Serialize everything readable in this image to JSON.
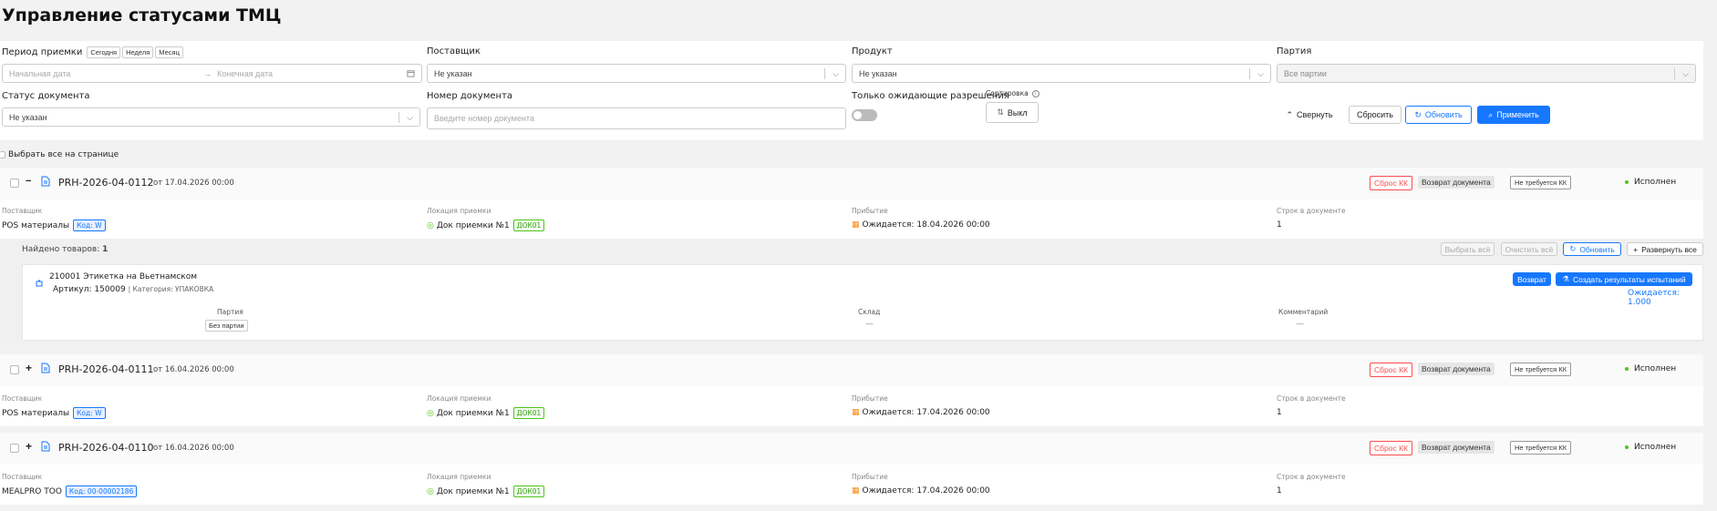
{
  "page": {
    "title": "Управление статусами ТМЦ"
  },
  "filters": {
    "period_label": "Период приемки",
    "period_presets": [
      "Сегодня",
      "Неделя",
      "Месяц"
    ],
    "start_date_placeholder": "Начальная дата",
    "date_arrow": "→",
    "end_date_placeholder": "Конечная дата",
    "supplier_label": "Поставщик",
    "supplier_value": "Не указан",
    "product_label": "Продукт",
    "product_value": "Не указан",
    "batch_label": "Партия",
    "batch_value": "Все партии",
    "doc_status_label": "Статус документа",
    "doc_status_value": "Не указан",
    "doc_number_label": "Номер документа",
    "doc_number_placeholder": "Введите номер документа",
    "pending_only_label": "Только ожидающие разрешения",
    "sort_label": "Сортировка",
    "sort_value": "Выкл",
    "collapse_label": "Свернуть",
    "reset_label": "Сбросить",
    "refresh_label": "Обновить",
    "apply_label": "Применить"
  },
  "select_all_label": "Выбрать все на странице",
  "labels": {
    "supplier": "Поставщик",
    "location": "Локация приемки",
    "arrival": "Прибытие",
    "lines": "Строк в документе",
    "from": "от"
  },
  "documents": [
    {
      "number": "PRH-2026-04-0112",
      "date": "17.04.2026 00:00",
      "expand_glyph": "−",
      "tags": [
        "Сброс КК",
        "Возврат документа",
        "Не требуется КК"
      ],
      "status": "Исполнен",
      "supplier": "POS материалы",
      "supplier_code": "Код: W",
      "location": "Док приемки №1",
      "location_code": "ДОК01",
      "arrival": "Ожидается: 18.04.2026 00:00",
      "lines": "1"
    },
    {
      "number": "PRH-2026-04-0111",
      "date": "16.04.2026 00:00",
      "expand_glyph": "+",
      "tags": [
        "Сброс КК",
        "Возврат документа",
        "Не требуется КК"
      ],
      "status": "Исполнен",
      "supplier": "POS материалы",
      "supplier_code": "Код: W",
      "location": "Док приемки №1",
      "location_code": "ДОК01",
      "arrival": "Ожидается: 17.04.2026 00:00",
      "lines": "1"
    },
    {
      "number": "PRH-2026-04-0110",
      "date": "16.04.2026 00:00",
      "expand_glyph": "+",
      "tags": [
        "Сброс КК",
        "Возврат документа",
        "Не требуется КК"
      ],
      "status": "Исполнен",
      "supplier": "MEALPRO TOO",
      "supplier_code": "Код: 00-00002186",
      "location": "Док приемки №1",
      "location_code": "ДОК01",
      "arrival": "Ожидается: 17.04.2026 00:00",
      "lines": "1"
    }
  ],
  "items_panel": {
    "found_label": "Найдено товаров:",
    "found_count": "1",
    "select_all": "Выбрать всё",
    "clear_all": "Очистить всё",
    "refresh": "Обновить",
    "expand_all": "Развернуть все",
    "item": {
      "name": "210001 Этикетка на Вьетнамском",
      "article": "Артикул: 150009",
      "category": "| Категория: УПАКОВКА",
      "return_btn": "Возврат",
      "create_results_btn": "Создать результаты испытаний",
      "expected": "Ожидается: 1.000",
      "batch_label": "Партия",
      "batch_value": "Без партии",
      "warehouse_label": "Склад",
      "warehouse_value": "—",
      "comment_label": "Комментарий",
      "comment_value": "—"
    }
  },
  "colors": {
    "accent": "#1677ff",
    "danger": "#ff4d4f",
    "success": "#52c41a",
    "warning": "#fa8c16"
  }
}
